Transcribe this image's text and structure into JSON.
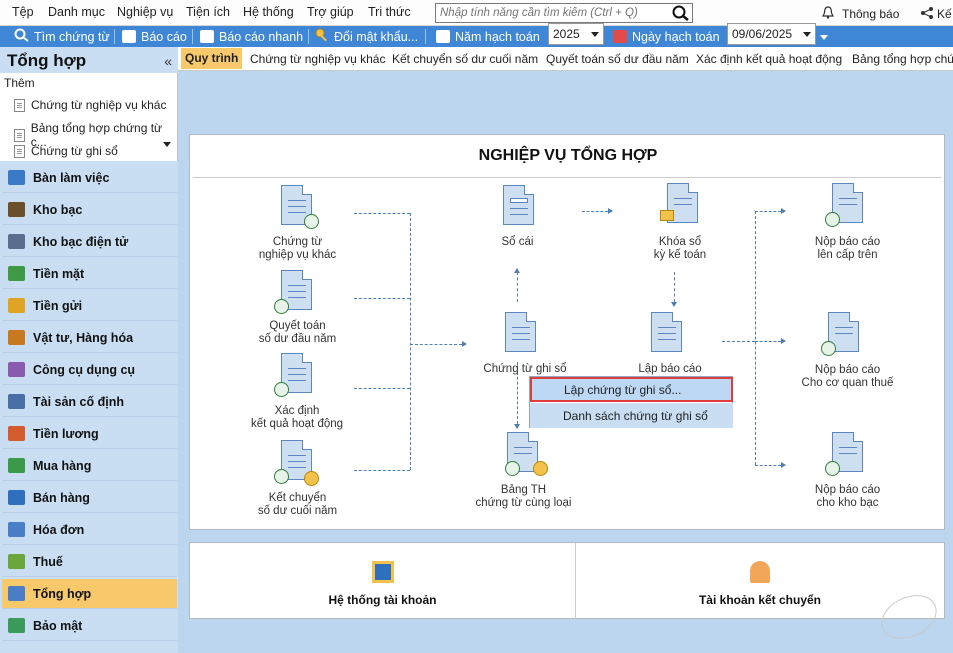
{
  "menu": {
    "items": [
      "Tệp",
      "Danh mục",
      "Nghiệp vụ",
      "Tiện ích",
      "Hệ thống",
      "Trợ giúp",
      "Tri thức"
    ],
    "search_placeholder": "Nhập tính năng cần tìm kiếm (Ctrl + Q)",
    "notification": "Thông báo",
    "share": "Kế"
  },
  "toolbar": {
    "find_voucher": "Tìm chứng từ",
    "report": "Báo cáo",
    "quick_report": "Báo cáo nhanh",
    "change_password": "Đổi mật khẩu...",
    "fiscal_year_label": "Năm hạch toán",
    "fiscal_year_value": "2025",
    "posting_date_label": "Ngày hạch toán",
    "posting_date_value": "09/06/2025"
  },
  "sidebar": {
    "title": "Tổng hợp",
    "add_label": "Thêm",
    "quick_links": [
      "Chứng từ nghiệp vụ khác",
      "Bảng tổng hợp chứng từ c...",
      "Chứng từ ghi sổ"
    ],
    "modules": [
      {
        "label": "Bàn làm việc",
        "color": "#3a78c8"
      },
      {
        "label": "Kho bạc",
        "color": "#6b4f2a"
      },
      {
        "label": "Kho bạc điện tử",
        "color": "#5a6e8f"
      },
      {
        "label": "Tiền mặt",
        "color": "#3e9a45"
      },
      {
        "label": "Tiền gửi",
        "color": "#e0a425"
      },
      {
        "label": "Vật tư, Hàng hóa",
        "color": "#c8781e"
      },
      {
        "label": "Công cụ dụng cụ",
        "color": "#8a5ab0"
      },
      {
        "label": "Tài sản cố định",
        "color": "#4a6fa8"
      },
      {
        "label": "Tiền lương",
        "color": "#d35b2c"
      },
      {
        "label": "Mua hàng",
        "color": "#3a9a4a"
      },
      {
        "label": "Bán hàng",
        "color": "#2f6fc0"
      },
      {
        "label": "Hóa đơn",
        "color": "#4a7ec8"
      },
      {
        "label": "Thuế",
        "color": "#6aa63a"
      },
      {
        "label": "Tổng hợp",
        "color": "#4a7ec8"
      },
      {
        "label": "Bảo mật",
        "color": "#3c9a5a"
      }
    ]
  },
  "tabs": [
    "Quy trình",
    "Chứng từ nghiệp vụ khác",
    "Kết chuyển số dư cuối năm",
    "Quyết toán số dư đầu năm",
    "Xác định kết quả hoạt động",
    "Bảng tổng hợp chứng"
  ],
  "process": {
    "title": "NGHIỆP VỤ TỔNG HỢP",
    "nodes": {
      "other_voucher": "Chứng từ\nnghiệp vụ khác",
      "opening_balance": "Quyết toán\nsố dư đầu năm",
      "operating_result": "Xác định\nkết quả hoạt động",
      "year_end_transfer": "Kết chuyển\nsố dư cuối năm",
      "ledger": "Sổ cái",
      "voucher_book": "Chứng từ ghi sổ",
      "summary_same_type": "Bảng TH\nchứng từ cùng loại",
      "lock_book": "Khóa sổ\nkỳ kế toán",
      "make_report": "Lập báo cáo",
      "report_superior": "Nộp báo cáo\nlên cấp trên",
      "report_tax": "Nộp báo cáo\nCho cơ quan thuế",
      "report_treasury": "Nộp báo cáo\ncho kho bạc"
    },
    "popup": {
      "create_voucher": "Lập chứng từ ghi sổ...",
      "voucher_list": "Danh sách chứng từ ghi sổ"
    }
  },
  "bottom": {
    "account_system": "Hệ thống tài khoản",
    "transfer_account": "Tài khoản kết chuyển"
  }
}
